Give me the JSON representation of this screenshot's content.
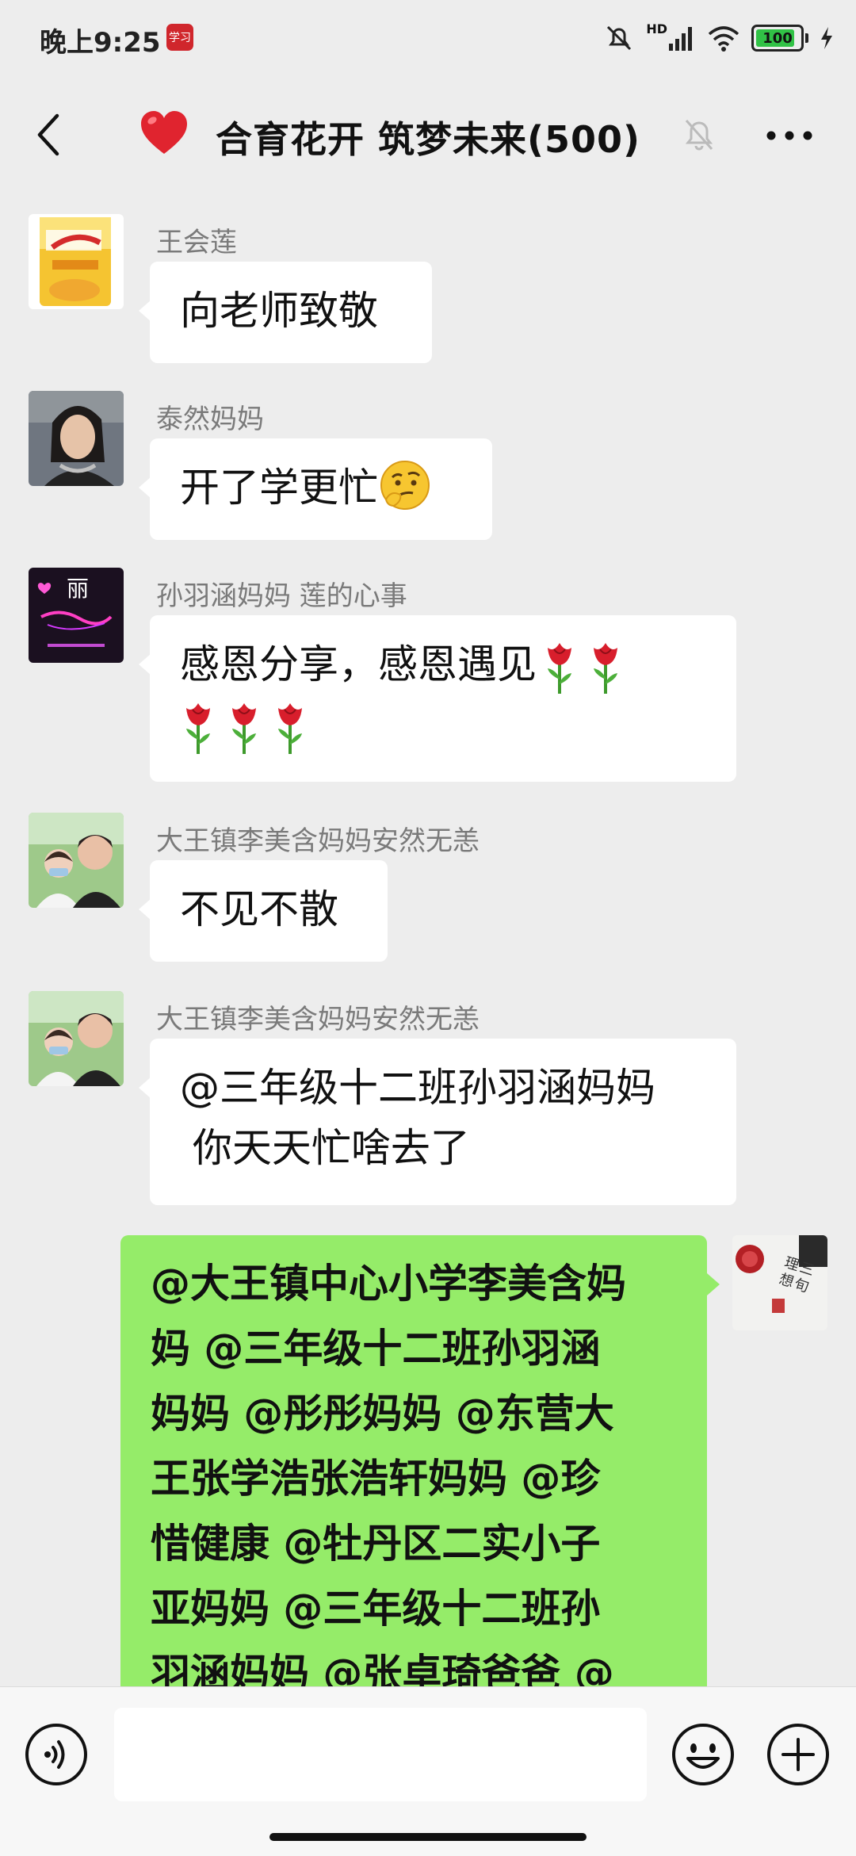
{
  "status_bar": {
    "time": "晚上9:25",
    "app_badge": "学习",
    "network": "HD",
    "battery": "100",
    "icons": [
      "mute-bell-icon",
      "signal-icon",
      "wifi-icon",
      "battery-icon",
      "charging-icon"
    ]
  },
  "header": {
    "title": "合育花开 筑梦未来(500)",
    "icons": [
      "back-icon",
      "heart-icon",
      "mute-icon",
      "more-icon"
    ]
  },
  "messages": [
    {
      "sender": "王会莲",
      "text": "向老师致敬",
      "avatar": "product-package-avatar"
    },
    {
      "sender": "泰然妈妈",
      "text": "开了学更忙",
      "emoji": "thinking-face-emoji",
      "avatar": "woman-portrait-avatar"
    },
    {
      "sender": "孙羽涵妈妈  莲的心事",
      "line1": "感恩分享，感恩遇见",
      "avatar": "neon-sign-avatar",
      "avatar_text": "丽",
      "emoji": "rose-emoji",
      "rose_count": 5
    },
    {
      "sender": "大王镇李美含妈妈安然无恙",
      "text": "不见不散",
      "avatar": "mother-child-avatar"
    },
    {
      "sender": "大王镇李美含妈妈安然无恙",
      "line1": "@三年级十二班孙羽涵妈妈",
      "line2": " 你天天忙啥去了",
      "avatar": "mother-child-avatar"
    }
  ],
  "my_message": {
    "lines": [
      "@大王镇中心小学李美含妈",
      "妈 @三年级十二班孙羽涵",
      "妈妈 @彤彤妈妈 @东营大",
      "王张学浩张浩轩妈妈 @珍",
      "惜健康 @牡丹区二实小子",
      "亚妈妈 @三年级十二班孙",
      "羽涵妈妈 @张卓琦爸爸 @"
    ],
    "avatar": "calligraphy-avatar",
    "avatar_text": "理想三旬"
  },
  "input_bar": {
    "placeholder": "",
    "icons": [
      "voice-icon",
      "emoji-icon",
      "plus-icon"
    ]
  },
  "colors": {
    "background": "#ededed",
    "my_bubble": "#95ec69",
    "other_bubble": "#ffffff"
  }
}
